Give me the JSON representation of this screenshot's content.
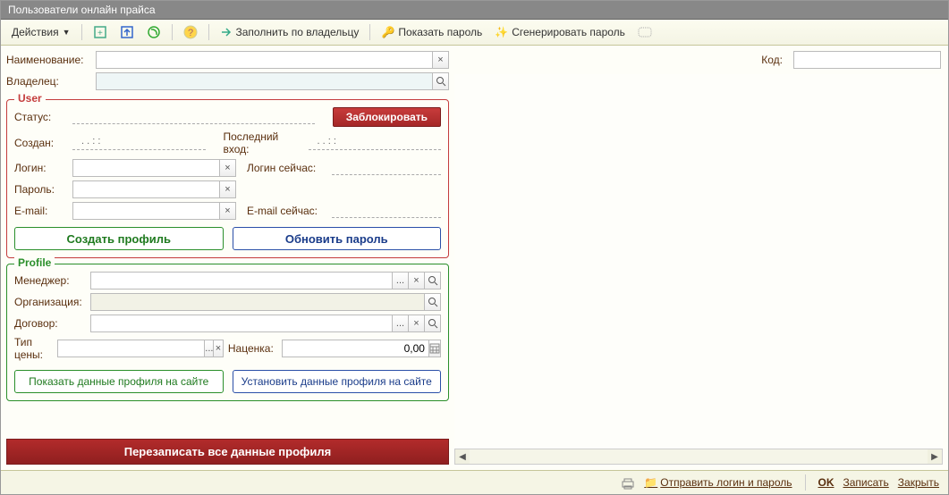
{
  "title": "Пользователи онлайн прайса",
  "toolbar": {
    "actions": "Действия",
    "fill_by_owner": "Заполнить по владельцу",
    "show_password": "Показать пароль",
    "generate_password": "Сгенерировать пароль"
  },
  "fields": {
    "name_label": "Наименование:",
    "owner_label": "Владелец:",
    "code_label": "Код:"
  },
  "user": {
    "legend": "User",
    "status_label": "Статус:",
    "block_btn": "Заблокировать",
    "created_label": "Создан:",
    "created_val": ".  .      :  :",
    "last_login_label": "Последний вход:",
    "last_login_val": ".  .      :  :",
    "login_label": "Логин:",
    "login_now_label": "Логин сейчас:",
    "password_label": "Пароль:",
    "email_label": "E-mail:",
    "email_now_label": "E-mail сейчас:",
    "create_btn": "Создать профиль",
    "update_btn": "Обновить пароль"
  },
  "profile": {
    "legend": "Profile",
    "manager_label": "Менеджер:",
    "org_label": "Организация:",
    "contract_label": "Договор:",
    "price_type_label": "Тип цены:",
    "markup_label": "Наценка:",
    "markup_val": "0,00",
    "show_btn": "Показать данные профиля на сайте",
    "set_btn": "Установить данные профиля на сайте"
  },
  "rewrite_btn": "Перезаписать все данные профиля",
  "status": {
    "send": "Отправить логин и пароль",
    "ok": "OK",
    "save": "Записать",
    "close": "Закрыть"
  }
}
